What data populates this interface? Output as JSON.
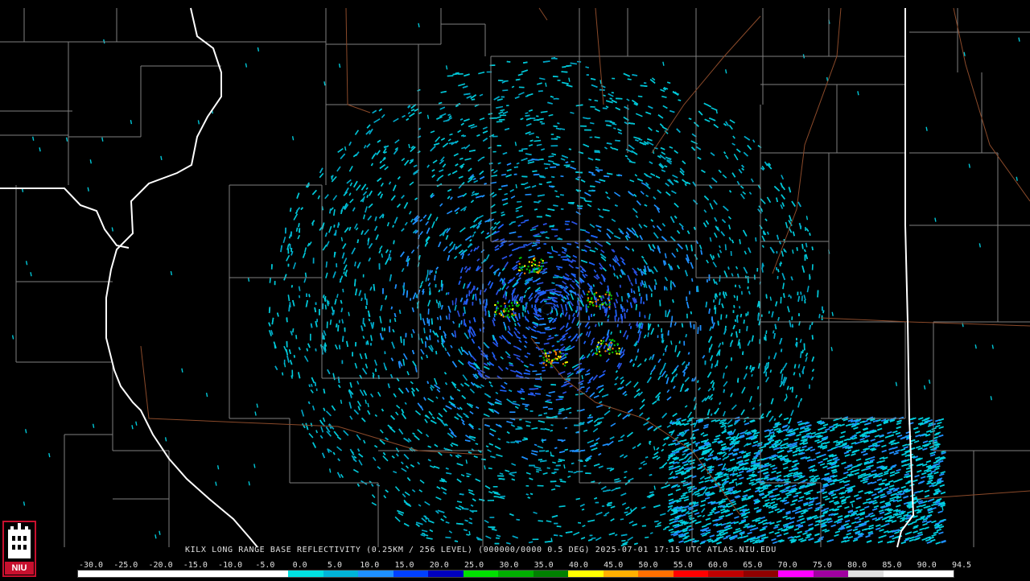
{
  "product": {
    "station": "KILX",
    "caption": "KILX LONG RANGE BASE REFLECTIVITY (0.25KM / 256 LEVEL) (000000/0000 0.5 DEG) 2025-07-01 17:15 UTC  ATLAS.NIU.EDU"
  },
  "logo": {
    "text": "NIU",
    "color": "#c8102e"
  },
  "colors": {
    "background": "#000000",
    "county_lines": "#7f7f7f",
    "state_lines": "#ffffff",
    "roads": "#8b4a2a",
    "echo_light": "#00c8d8",
    "echo_mid": "#1e64ff",
    "echo_heavy": "#1f3cd0"
  },
  "scale": {
    "labels": [
      "-30.0",
      "-25.0",
      "-20.0",
      "-15.0",
      "-10.0",
      "-5.0",
      "0.0",
      "5.0",
      "10.0",
      "15.0",
      "20.0",
      "25.0",
      "30.0",
      "35.0",
      "40.0",
      "45.0",
      "50.0",
      "55.0",
      "60.0",
      "65.0",
      "70.0",
      "75.0",
      "80.0",
      "85.0",
      "90.0",
      "94.5"
    ],
    "colors": [
      "#ffffff",
      "#ffffff",
      "#ffffff",
      "#ffffff",
      "#ffffff",
      "#ffffff",
      "#00e0e0",
      "#00b4d8",
      "#1e90ff",
      "#0040ff",
      "#0000c0",
      "#00e000",
      "#00b000",
      "#008000",
      "#ffff00",
      "#ffb000",
      "#ff7000",
      "#ff0000",
      "#c00000",
      "#900000",
      "#ff00ff",
      "#a000a0",
      "#e0e0e0",
      "#ffffff",
      "#ffffff"
    ]
  }
}
